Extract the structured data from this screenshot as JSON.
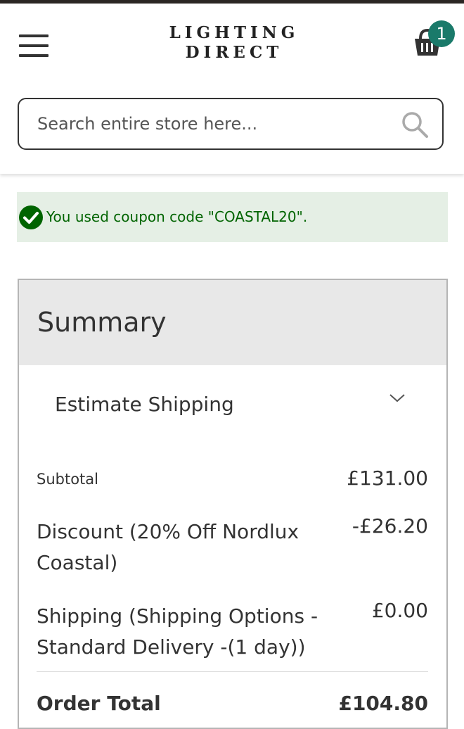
{
  "header": {
    "logo_line1": "LIGHTING",
    "logo_line2": "DIRECT",
    "cart_count": "1",
    "menu_icon": "hamburger-icon",
    "cart_icon": "basket-icon"
  },
  "search": {
    "placeholder": "Search entire store here...",
    "value": "",
    "icon": "search-icon"
  },
  "notice": {
    "message": "You used coupon code \"COASTAL20\".",
    "icon": "check-circle-icon",
    "color": "#006400",
    "background": "#e5efe5"
  },
  "summary": {
    "title": "Summary",
    "estimate_shipping_label": "Estimate Shipping",
    "rows": {
      "subtotal": {
        "label": "Subtotal",
        "value": "£131.00"
      },
      "discount": {
        "label": "Discount (20% Off Nordlux Coastal)",
        "value": "-£26.20"
      },
      "shipping": {
        "label": "Shipping (Shipping Options - Standard Delivery -(1 day))",
        "value": "£0.00"
      },
      "order_total": {
        "label": "Order Total",
        "value": "£104.80"
      }
    }
  },
  "colors": {
    "accent": "#1a7a6a",
    "text": "#333333",
    "summary_header_bg": "#e8e8e8"
  }
}
